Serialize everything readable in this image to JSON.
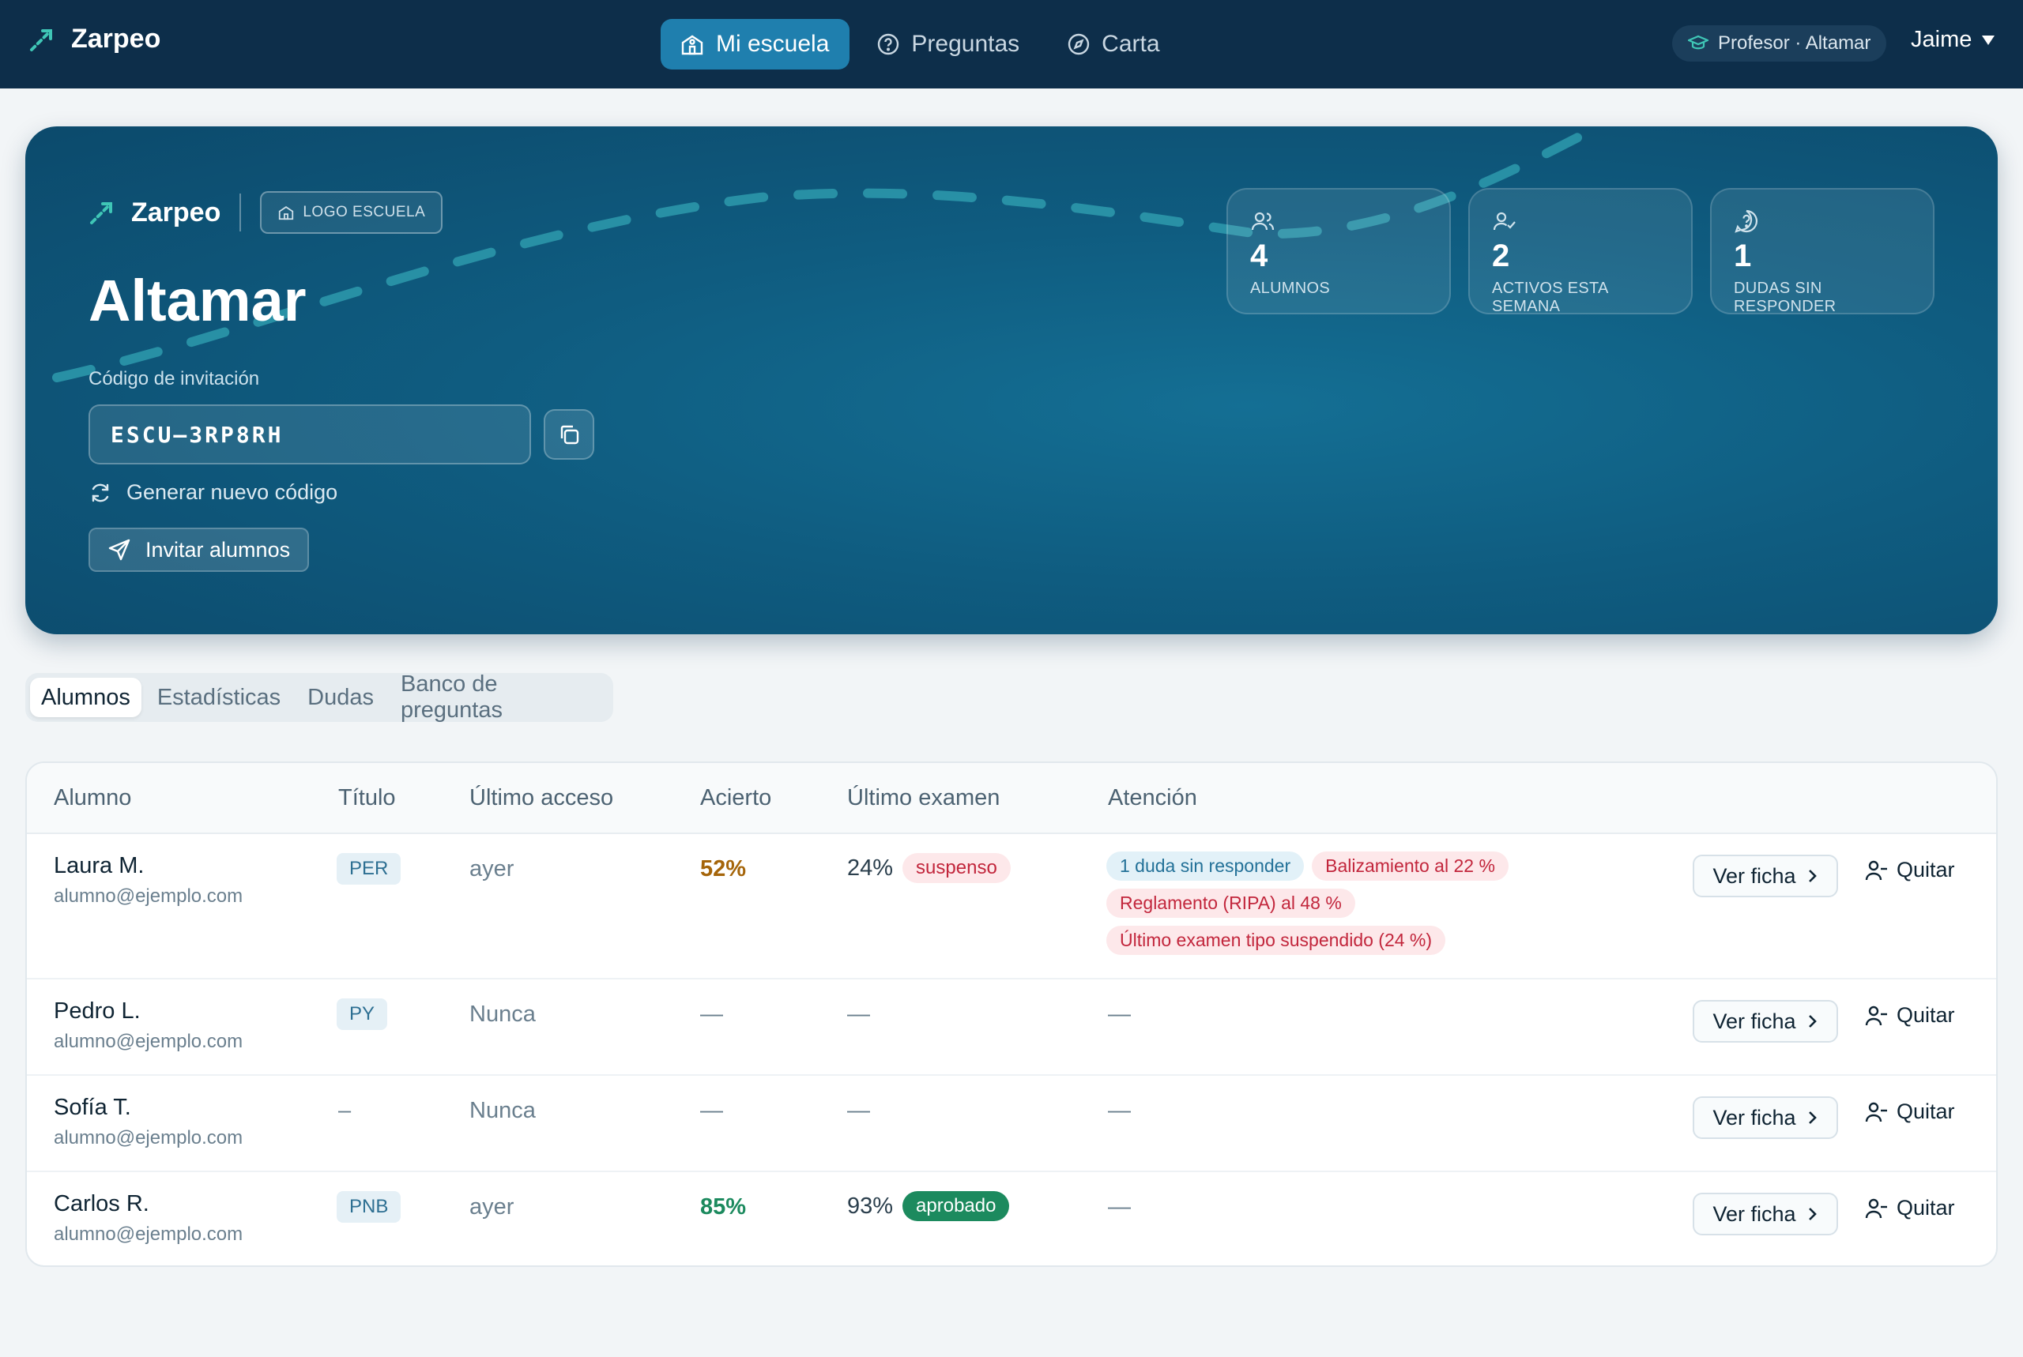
{
  "nav": {
    "brand": "Zarpeo",
    "tabs": [
      {
        "label": "Mi escuela",
        "icon": "school-icon"
      },
      {
        "label": "Preguntas",
        "icon": "help-circle-icon"
      },
      {
        "label": "Carta",
        "icon": "compass-icon"
      }
    ],
    "role_badge": "Profesor · Altamar",
    "user": "Jaime"
  },
  "hero": {
    "brand": "Zarpeo",
    "logo_placeholder": "LOGO ESCUELA",
    "school_name": "Altamar",
    "invite_label": "Código de invitación",
    "invite_code": "ESCU–3RP8RH",
    "regenerate_label": "Generar nuevo código",
    "invite_button": "Invitar alumnos",
    "stats": [
      {
        "value": "4",
        "label": "ALUMNOS",
        "icon": "users-icon"
      },
      {
        "value": "2",
        "label": "ACTIVOS ESTA SEMANA",
        "icon": "user-check-icon"
      },
      {
        "value": "1",
        "label": "DUDAS SIN RESPONDER",
        "icon": "question-bubble-icon"
      }
    ]
  },
  "tabs": [
    "Alumnos",
    "Estadísticas",
    "Dudas",
    "Banco de preguntas"
  ],
  "table": {
    "headers": [
      "Alumno",
      "Título",
      "Último acceso",
      "Acierto",
      "Último examen",
      "Atención"
    ],
    "view_label": "Ver ficha",
    "remove_label": "Quitar",
    "rows": [
      {
        "name": "Laura M.",
        "email": "alumno@ejemplo.com",
        "title": "PER",
        "last_access": "ayer",
        "accuracy": "52%",
        "accuracy_color": "#a5650a",
        "exam_score": "24%",
        "exam_status": "suspenso",
        "attention": [
          {
            "text": "1 duda sin responder",
            "kind": "info"
          },
          {
            "text": "Balizamiento al 22 %",
            "kind": "warn"
          },
          {
            "text": "Reglamento (RIPA) al 48 %",
            "kind": "warn"
          },
          {
            "text": "Último examen tipo suspendido (24 %)",
            "kind": "warn"
          }
        ]
      },
      {
        "name": "Pedro L.",
        "email": "alumno@ejemplo.com",
        "title": "PY",
        "last_access": "Nunca",
        "accuracy": "—",
        "exam_score": "—",
        "attention_empty": "—"
      },
      {
        "name": "Sofía T.",
        "email": "alumno@ejemplo.com",
        "title": "–",
        "last_access": "Nunca",
        "accuracy": "—",
        "exam_score": "—",
        "attention_empty": "—"
      },
      {
        "name": "Carlos R.",
        "email": "alumno@ejemplo.com",
        "title": "PNB",
        "last_access": "ayer",
        "accuracy": "85%",
        "accuracy_color": "#1c8a5e",
        "exam_score": "93%",
        "exam_status": "aprobado",
        "attention_empty": "—"
      }
    ]
  },
  "colors": {
    "nav_bg": "#0d2e4a",
    "accent": "#1f7fae",
    "brand_teal": "#3fc6b6",
    "fail": "#c2263c",
    "pass": "#1c8a5e"
  }
}
